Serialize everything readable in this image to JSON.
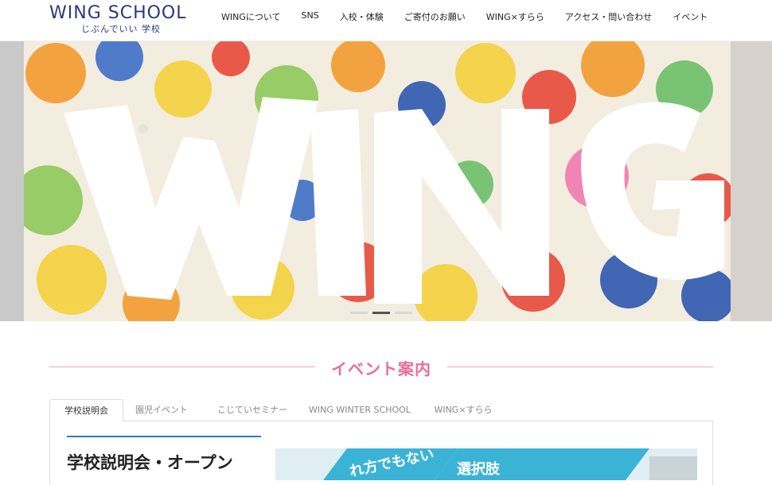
{
  "header": {
    "logo_main": "WING SCHOOL",
    "logo_sub": "じぶんでいい 学校",
    "nav": [
      "WINGについて",
      "SNS",
      "入校・体験",
      "ご寄付のお願い",
      "WING×すらら",
      "アクセス・問い合わせ",
      "イベント"
    ]
  },
  "hero": {
    "art_text": "WING",
    "slides_count": 3,
    "active_slide": 1
  },
  "event_section": {
    "title": "イベント案内",
    "tabs": [
      "学校説明会",
      "園児イベント",
      "こじていセミナー",
      "WING WINTER SCHOOL",
      "WING×すらら"
    ],
    "active_tab": 0,
    "panel_heading": "学校説明会・オープン",
    "banner_text_1": "れ方でもない",
    "banner_text_2": "選択肢"
  },
  "colors": {
    "accent_pink": "#ea6d97",
    "logo_navy": "#2a3a78",
    "rule_blue": "#2f78c4",
    "banner_cyan": "#3bb3d6"
  }
}
